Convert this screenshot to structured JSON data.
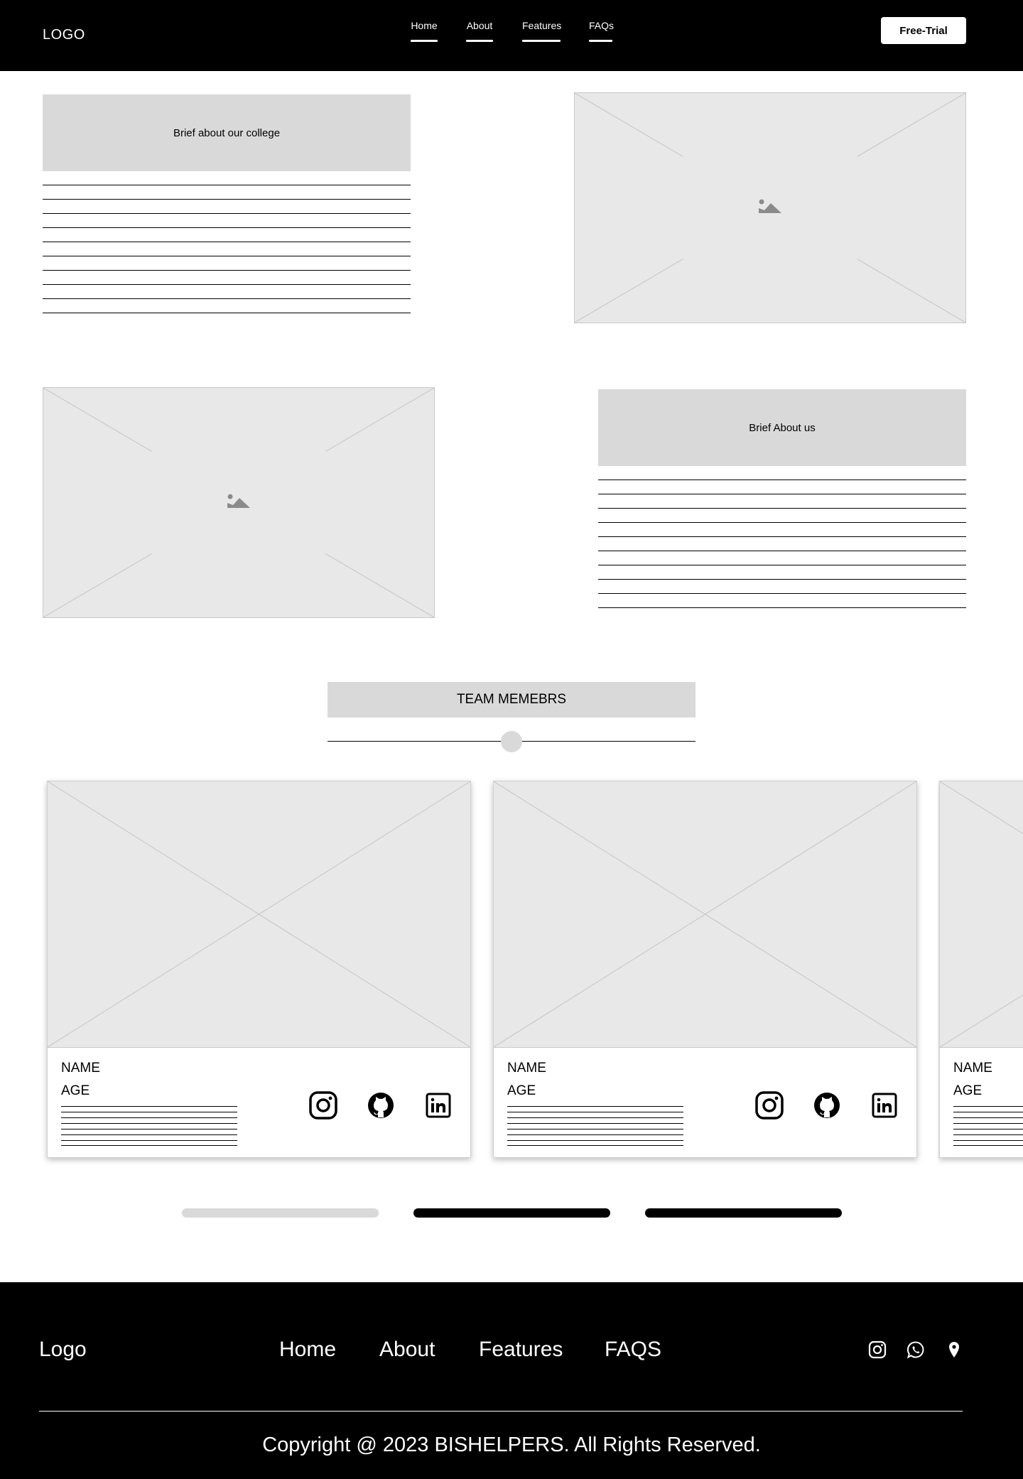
{
  "header": {
    "logo": "LOGO",
    "nav": [
      "Home",
      "About",
      "Features",
      "FAQs"
    ],
    "cta": "Free-Trial"
  },
  "about_college": {
    "heading": "Brief about our college"
  },
  "about_us": {
    "heading": "Brief About us"
  },
  "team": {
    "title": "TEAM MEMEBRS",
    "slider_position": 0.5,
    "members": [
      {
        "name": "NAME",
        "age": "AGE"
      },
      {
        "name": "NAME",
        "age": "AGE"
      },
      {
        "name": "NAME",
        "age": "AGE"
      }
    ],
    "pagination": [
      "inactive",
      "active",
      "active"
    ]
  },
  "footer": {
    "logo": "Logo",
    "nav": [
      "Home",
      "About",
      "Features",
      "FAQS"
    ],
    "icons": [
      "instagram-icon",
      "whatsapp-icon",
      "location-pin-icon"
    ],
    "copyright": "Copyright @ 2023 BISHELPERS. All Rights Reserved."
  },
  "colors": {
    "header_bg": "#000000",
    "panel_gray": "#d9d9d9",
    "placeholder_gray": "#e8e8e8"
  }
}
